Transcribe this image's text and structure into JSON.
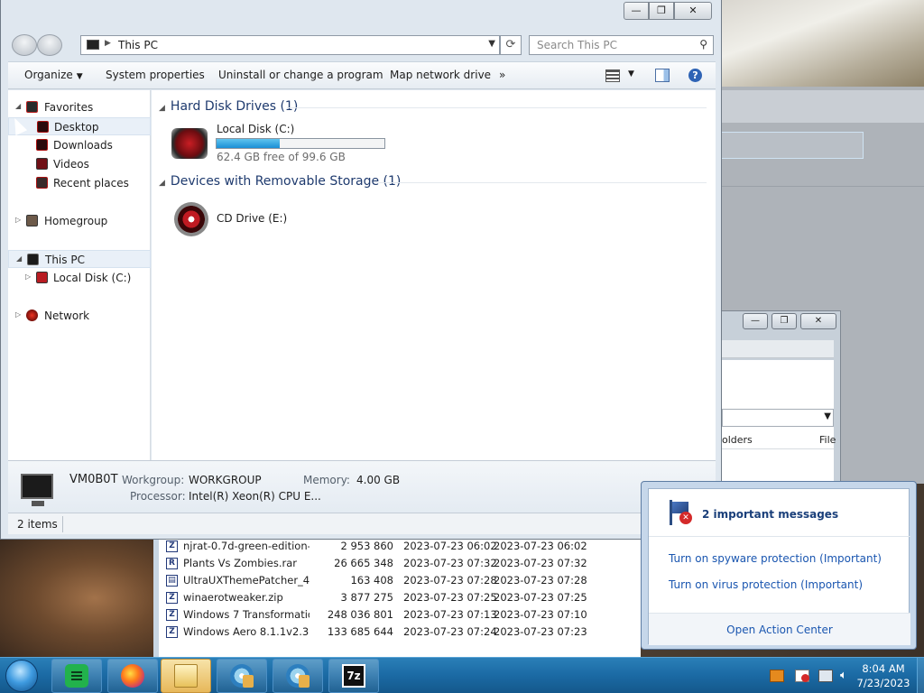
{
  "explorer": {
    "title_buttons": {
      "minimize": "—",
      "maximize": "❐",
      "close": "✕"
    },
    "address_path": "This PC",
    "search_placeholder": "Search This PC",
    "toolbar": {
      "organize": "Organize",
      "system_properties": "System properties",
      "uninstall": "Uninstall or change a program",
      "map_drive": "Map network drive",
      "more": "»"
    },
    "nav": {
      "favorites": "Favorites",
      "desktop": "Desktop",
      "downloads": "Downloads",
      "videos": "Videos",
      "recent_places": "Recent places",
      "homegroup": "Homegroup",
      "this_pc": "This PC",
      "local_disk": "Local Disk (C:)",
      "network": "Network"
    },
    "content": {
      "hard_disk_group": "Hard Disk Drives (1)",
      "local_disk_name": "Local Disk (C:)",
      "local_disk_free": "62.4 GB free of 99.6 GB",
      "local_disk_used_fraction": 0.374,
      "removable_group": "Devices with Removable Storage (1)",
      "cd_drive_name": "CD Drive (E:)"
    },
    "details": {
      "computer_name": "VM0B0T",
      "workgroup_label": "Workgroup:",
      "workgroup_value": "WORKGROUP",
      "memory_label": "Memory:",
      "memory_value": "4.00 GB",
      "processor_label": "Processor:",
      "processor_value": "Intel(R) Xeon(R) CPU E..."
    },
    "status": {
      "items": "2 items"
    }
  },
  "file_list": [
    {
      "name": "njrat-0.7d-green-edition-...",
      "size": "2 953 860",
      "modified": "2023-07-23 06:02",
      "created": "2023-07-23 06:02",
      "icon": "Z"
    },
    {
      "name": "Plants Vs Zombies.rar",
      "size": "26 665 348",
      "modified": "2023-07-23 07:32",
      "created": "2023-07-23 07:32",
      "icon": "R"
    },
    {
      "name": "UltraUXThemePatcher_4....",
      "size": "163 408",
      "modified": "2023-07-23 07:28",
      "created": "2023-07-23 07:28",
      "icon": "▤"
    },
    {
      "name": "winaerotweaker.zip",
      "size": "3 877 275",
      "modified": "2023-07-23 07:25",
      "created": "2023-07-23 07:25",
      "icon": "Z"
    },
    {
      "name": "Windows 7 Transformatio...",
      "size": "248 036 801",
      "modified": "2023-07-23 07:13",
      "created": "2023-07-23 07:10",
      "icon": "Z"
    },
    {
      "name": "Windows Aero 8.1.1v2.3.zip",
      "size": "133 685 644",
      "modified": "2023-07-23 07:24",
      "created": "2023-07-23 07:23",
      "icon": "Z"
    }
  ],
  "zip_window": {
    "col_folders": "olders",
    "col_file": "File"
  },
  "action_center": {
    "header": "2 important messages",
    "msg1": "Turn on spyware protection (Important)",
    "msg2": "Turn on virus protection (Important)",
    "open_link": "Open Action Center"
  },
  "taskbar": {
    "time": "8:04 AM",
    "date": "7/23/2023",
    "sevenzip_label": "7z"
  }
}
